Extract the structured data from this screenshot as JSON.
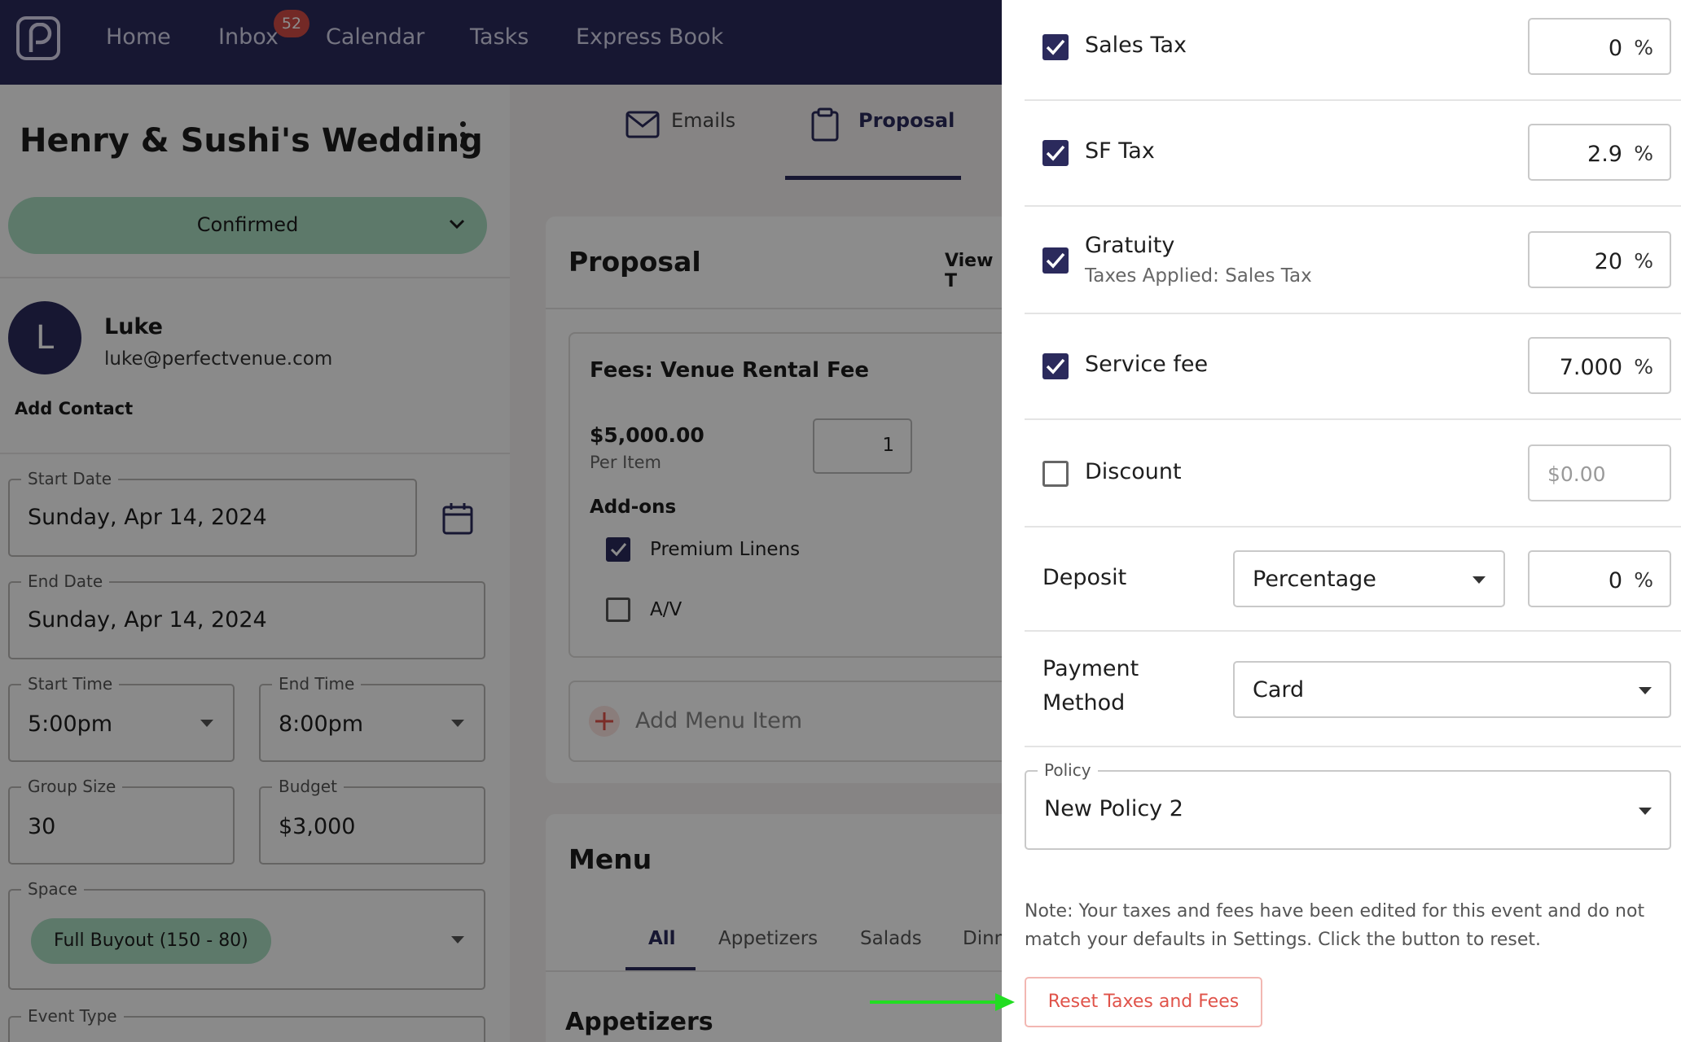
{
  "nav": {
    "items": [
      "Home",
      "Inbox",
      "Calendar",
      "Tasks",
      "Express Book"
    ],
    "inbox_badge": "52"
  },
  "event": {
    "title": "Henry & Sushi's Wedding",
    "status": "Confirmed",
    "contact": {
      "initial": "L",
      "name": "Luke",
      "email": "luke@perfectvenue.com"
    },
    "add_contact": "Add Contact",
    "start_date": {
      "label": "Start Date",
      "value": "Sunday, Apr 14, 2024"
    },
    "end_date": {
      "label": "End Date",
      "value": "Sunday, Apr 14, 2024"
    },
    "start_time": {
      "label": "Start Time",
      "value": "5:00pm"
    },
    "end_time": {
      "label": "End Time",
      "value": "8:00pm"
    },
    "group_size": {
      "label": "Group Size",
      "value": "30"
    },
    "budget": {
      "label": "Budget",
      "value": "$3,000"
    },
    "space": {
      "label": "Space",
      "value": "Full Buyout (150 - 80)"
    },
    "event_type": {
      "label": "Event Type"
    }
  },
  "tabs": {
    "emails": "Emails",
    "proposal": "Proposal"
  },
  "proposal": {
    "title": "Proposal",
    "view_text": "View T",
    "fee_title": "Fees: Venue Rental Fee",
    "price": "$5,000.00",
    "per_item": "Per Item",
    "qty": "1",
    "addons_label": "Add-ons",
    "addons": [
      {
        "label": "Premium Linens",
        "checked": true
      },
      {
        "label": "A/V",
        "checked": false
      }
    ],
    "add_menu_item": "Add Menu Item"
  },
  "menu": {
    "title": "Menu",
    "tabs": [
      "All",
      "Appetizers",
      "Salads",
      "Dinn"
    ],
    "section": "Appetizers"
  },
  "drawer": {
    "rows": [
      {
        "label": "Sales Tax",
        "checked": true,
        "value": "0",
        "unit": "%"
      },
      {
        "label": "SF Tax",
        "checked": true,
        "value": "2.9",
        "unit": "%"
      },
      {
        "label": "Gratuity",
        "sub": "Taxes Applied: Sales Tax",
        "checked": true,
        "value": "20",
        "unit": "%"
      },
      {
        "label": "Service fee",
        "checked": true,
        "value": "7.000",
        "unit": "%"
      },
      {
        "label": "Discount",
        "checked": false,
        "placeholder": "$0.00"
      }
    ],
    "deposit": {
      "label": "Deposit",
      "type": "Percentage",
      "value": "0",
      "unit": "%"
    },
    "payment": {
      "label_line1": "Payment",
      "label_line2": "Method",
      "value": "Card"
    },
    "policy": {
      "label": "Policy",
      "value": "New Policy 2"
    },
    "note": "Note: Your taxes and fees have been edited for this event and do not match your defaults in Settings. Click the button to reset.",
    "reset_button": "Reset Taxes and Fees"
  },
  "colors": {
    "brand": "#2b2a5c",
    "status_green": "#a9dcc2",
    "danger": "#e0534a",
    "arrow": "#22dd22"
  }
}
